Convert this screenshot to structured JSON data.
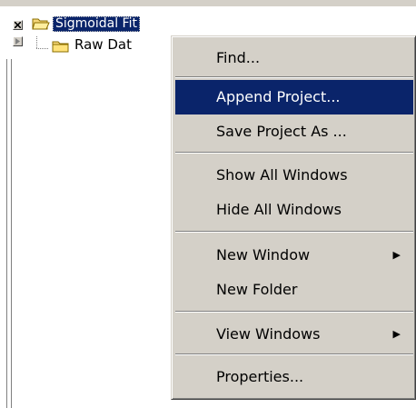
{
  "tree": {
    "root_label": "Sigmoidal Fit",
    "child_label": "Raw Dat"
  },
  "menu": {
    "items": [
      {
        "label": "Find...",
        "highlighted": false
      },
      {
        "label": "Append Project...",
        "highlighted": true
      },
      {
        "label": "Save Project As ...",
        "highlighted": false
      },
      {
        "label": "Show All Windows",
        "highlighted": false
      },
      {
        "label": "Hide All Windows",
        "highlighted": false
      },
      {
        "label": "New Window",
        "submenu": true
      },
      {
        "label": "New Folder",
        "highlighted": false
      },
      {
        "label": "View Windows",
        "submenu": true
      },
      {
        "label": "Properties...",
        "highlighted": false
      }
    ],
    "submenu_arrow": "▶"
  },
  "colors": {
    "highlight": "#0a246a",
    "menu_bg": "#d4d0c8"
  }
}
